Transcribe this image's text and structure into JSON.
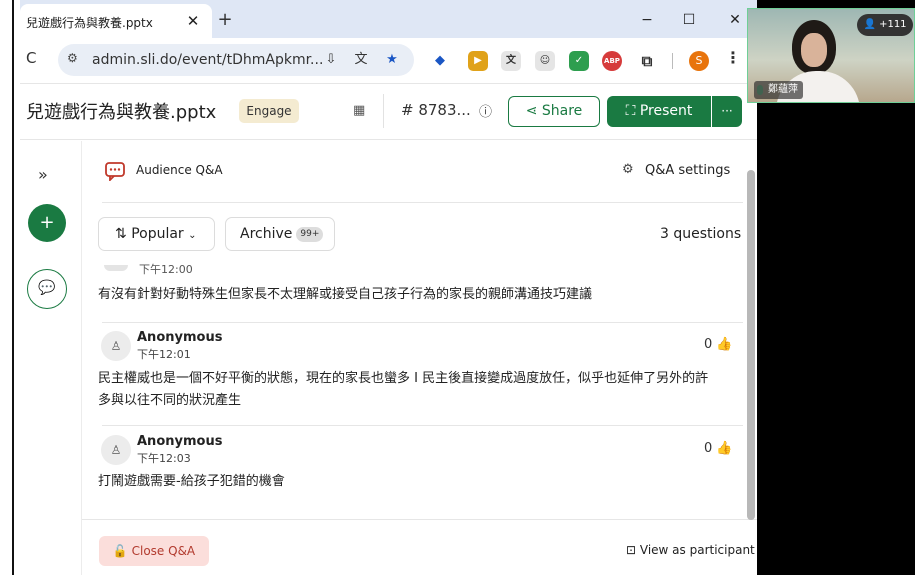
{
  "tab": {
    "title": "兒遊戲行為與教養.pptx",
    "close": "✕",
    "new": "+"
  },
  "window": {
    "minimize": "−",
    "maximize": "☐",
    "close": "✕"
  },
  "address": {
    "url": "admin.sli.do/event/tDhmApkmr..."
  },
  "extensions": {
    "profile_letter": "S",
    "abp": "ABP"
  },
  "header": {
    "title": "兒遊戲行為與教養.pptx",
    "engage": "Engage",
    "event_code": "# 8783...",
    "share": "Share",
    "present": "Present",
    "more": "···"
  },
  "sidebar": {
    "expand": "»",
    "add": "+"
  },
  "qa": {
    "title": "Audience Q&A",
    "settings": "Q&A settings",
    "sort_label": "Popular",
    "archive_label": "Archive",
    "archive_badge": "99+",
    "count": "3 questions",
    "questions": [
      {
        "time": "下午12:00",
        "text": "有沒有針對好動特殊生但家長不太理解或接受自己孩子行為的家長的親師溝通技巧建議"
      },
      {
        "author": "Anonymous",
        "time": "下午12:01",
        "likes": "0",
        "text_line1": "民主權威也是一個不好平衡的狀態，現在的家長也蠻多 I 民主後直接變成過度放任，似乎也延伸了另外的許",
        "text_line2": "多與以往不同的狀況產生"
      },
      {
        "author": "Anonymous",
        "time": "下午12:03",
        "likes": "0",
        "text": "打鬧遊戲需要-給孩子犯錯的機會"
      }
    ],
    "close": "Close Q&A",
    "view_participant": "View as participant"
  },
  "video": {
    "name": "鄭蘊萍",
    "participants": "+111"
  }
}
